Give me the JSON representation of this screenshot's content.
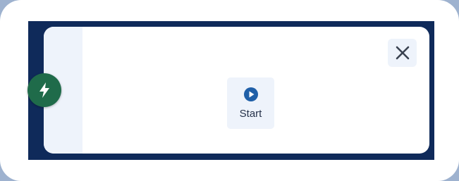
{
  "controls": {
    "start_label": "Start",
    "close_icon": "close-icon",
    "play_icon": "play-circle-icon",
    "badge_icon": "lightning-bolt-icon"
  },
  "colors": {
    "frame": "#0f2a5a",
    "badge": "#1f6b4a",
    "button_bg": "#eef3fb",
    "icon_blue": "#1f5fa8"
  }
}
